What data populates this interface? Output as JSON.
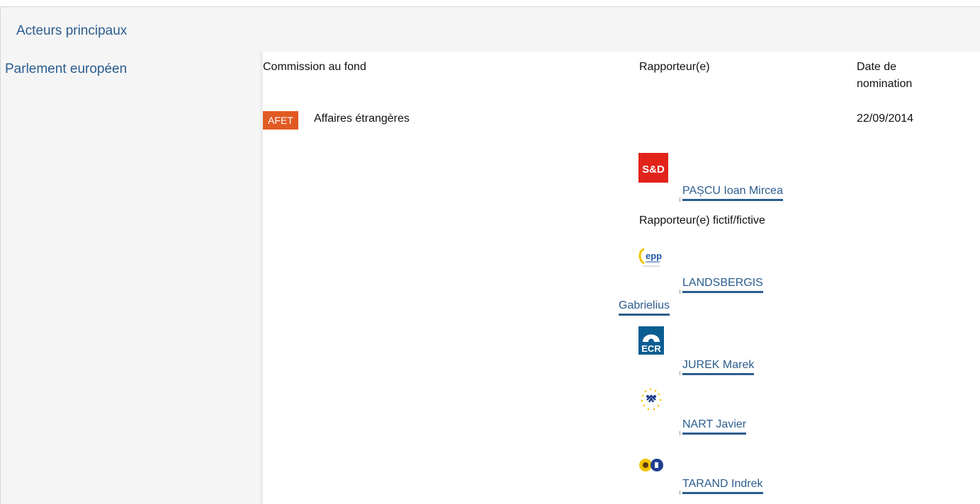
{
  "section": {
    "title": "Acteurs principaux"
  },
  "institution": {
    "name": "Parlement européen"
  },
  "table": {
    "col_committee": "Commission au fond",
    "col_rapporteur": "Rapporteur(e)",
    "col_date": "Date de nomination"
  },
  "committee": {
    "code": "AFET",
    "name": "Affaires étrangères",
    "date": "22/09/2014"
  },
  "rapporteur": {
    "name": "PAȘCU Ioan Mircea",
    "group_logo": "S&D"
  },
  "shadow_label": "Rapporteur(e) fictif/fictive",
  "shadow_rapporteurs": [
    {
      "name": "LANDSBERGIS Gabrielius",
      "group_logo": "epp"
    },
    {
      "name": "JUREK Marek",
      "group_logo": "ECR"
    },
    {
      "name": "NART Javier",
      "group_logo": "ALDE"
    },
    {
      "name": "TARAND Indrek",
      "group_logo": "Greens/EFA"
    }
  ],
  "colors": {
    "link": "#2b5d8e",
    "badge": "#e15a23",
    "sd_red": "#e2231a",
    "ecr_blue": "#0a5d92"
  }
}
